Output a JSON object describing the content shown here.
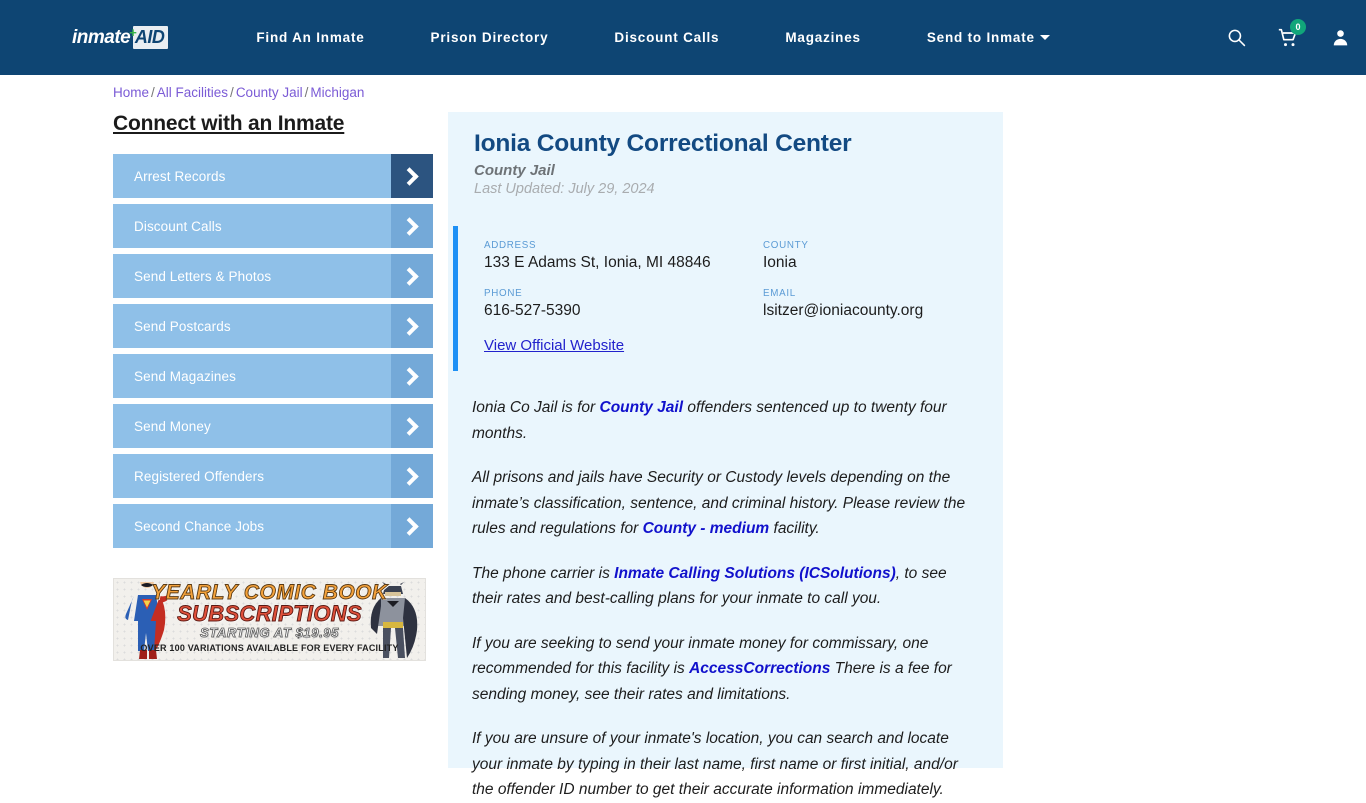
{
  "header": {
    "logo": {
      "primary": "inmate",
      "plus": "+",
      "secondary": "AID"
    },
    "nav_items": [
      {
        "label": "Find An Inmate",
        "has_caret": false
      },
      {
        "label": "Prison Directory",
        "has_caret": false
      },
      {
        "label": "Discount Calls",
        "has_caret": false
      },
      {
        "label": "Magazines",
        "has_caret": false
      },
      {
        "label": "Send to Inmate",
        "has_caret": true
      }
    ],
    "icons": {
      "search": "search-icon",
      "cart": "shopping-cart-icon",
      "cart_count": "0",
      "account": "user-account-icon"
    },
    "background_color": "#0e4573",
    "badge_color": "#11a67a"
  },
  "breadcrumb": {
    "items": [
      "Home",
      "All Facilities",
      "County Jail",
      "Michigan"
    ],
    "separator": "/",
    "link_color": "#7b5bd6"
  },
  "sidebar": {
    "title": "Connect with an Inmate",
    "items": [
      {
        "label": "Arrest Records",
        "active": true
      },
      {
        "label": "Discount Calls",
        "active": false
      },
      {
        "label": "Send Letters & Photos",
        "active": false
      },
      {
        "label": "Send Postcards",
        "active": false
      },
      {
        "label": "Send Magazines",
        "active": false
      },
      {
        "label": "Send Money",
        "active": false
      },
      {
        "label": "Registered Offenders",
        "active": false
      },
      {
        "label": "Second Chance Jobs",
        "active": false
      }
    ],
    "button_color": "#8fc0e8",
    "arrow_color": "#74a9d8",
    "arrow_active_color": "#2c5480"
  },
  "ad": {
    "line1": "YEARLY COMIC BOOK",
    "line2": "SUBSCRIPTIONS",
    "line3": "STARTING AT $19.95",
    "line4": "OVER 100 VARIATIONS AVAILABLE FOR EVERY FACILITY",
    "left_character": "superman-figure",
    "right_character": "batman-figure"
  },
  "facility": {
    "name": "Ionia County Correctional Center",
    "type": "County Jail",
    "last_updated": "Last Updated: July 29, 2024",
    "info": {
      "address_label": "ADDRESS",
      "address_value": "133 E Adams St, Ionia, MI 48846",
      "county_label": "COUNTY",
      "county_value": "Ionia",
      "phone_label": "PHONE",
      "phone_value": "616-527-5390",
      "email_label": "EMAIL",
      "email_value": "lsitzer@ioniacounty.org"
    },
    "website_link": "View Official Website",
    "accent_color": "#1e90f5",
    "panel_color": "#eaf6fd",
    "title_color": "#134a82"
  },
  "body": {
    "paragraphs": [
      {
        "parts": [
          {
            "text": "Ionia Co Jail is for ",
            "link": false
          },
          {
            "text": "County Jail",
            "link": true
          },
          {
            "text": " offenders sentenced up to twenty four months.",
            "link": false
          }
        ]
      },
      {
        "parts": [
          {
            "text": "All prisons and jails have Security or Custody levels depending on the inmate’s classification, sentence, and criminal history. Please review the rules and regulations for ",
            "link": false
          },
          {
            "text": "County - medium",
            "link": true
          },
          {
            "text": " facility.",
            "link": false
          }
        ]
      },
      {
        "parts": [
          {
            "text": "The phone carrier is ",
            "link": false
          },
          {
            "text": "Inmate Calling Solutions (ICSolutions)",
            "link": true
          },
          {
            "text": ", to see their rates and best-calling plans for your inmate to call you.",
            "link": false
          }
        ]
      },
      {
        "parts": [
          {
            "text": "If you are seeking to send your inmate money for commissary, one recommended for this facility is ",
            "link": false
          },
          {
            "text": "AccessCorrections",
            "link": true
          },
          {
            "text": " There is a fee for sending money, see their rates and limitations.",
            "link": false
          }
        ]
      },
      {
        "parts": [
          {
            "text": "If you are unsure of your inmate's location, you can search and locate your inmate by typing in their last name, first name or first initial, and/or the offender ID number to get their accurate information immediately.",
            "link": false
          }
        ]
      }
    ]
  }
}
